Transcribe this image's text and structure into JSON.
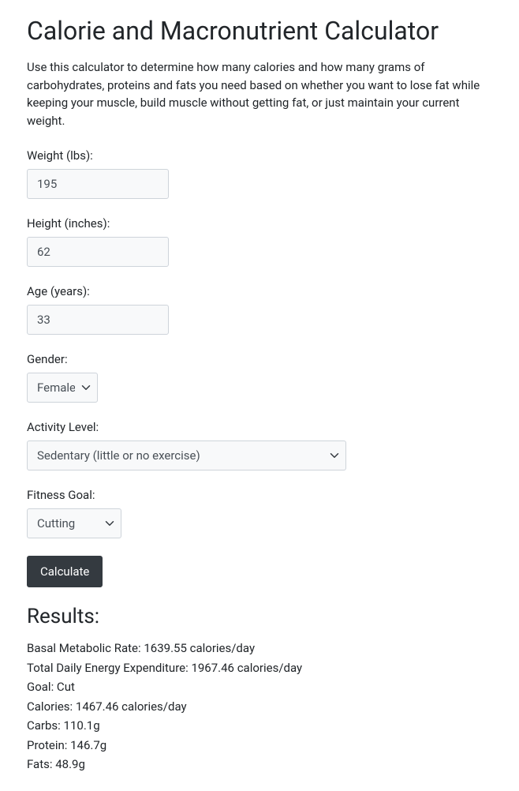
{
  "title": "Calorie and Macronutrient Calculator",
  "intro": "Use this calculator to determine how many calories and how many grams of carbohydrates, proteins and fats you need based on whether you want to lose fat while keeping your muscle, build muscle without getting fat, or just maintain your current weight.",
  "form": {
    "weight": {
      "label": "Weight (lbs):",
      "value": "195"
    },
    "height": {
      "label": "Height (inches):",
      "value": "62"
    },
    "age": {
      "label": "Age (years):",
      "value": "33"
    },
    "gender": {
      "label": "Gender:",
      "value": "Female"
    },
    "activity": {
      "label": "Activity Level:",
      "value": "Sedentary (little or no exercise)"
    },
    "goal": {
      "label": "Fitness Goal:",
      "value": "Cutting"
    },
    "submit": "Calculate"
  },
  "results": {
    "heading": "Results:",
    "bmr": "Basal Metabolic Rate: 1639.55 calories/day",
    "tdee": "Total Daily Energy Expenditure: 1967.46 calories/day",
    "goal": "Goal: Cut",
    "calories": "Calories: 1467.46 calories/day",
    "carbs": "Carbs: 110.1g",
    "protein": "Protein: 146.7g",
    "fats": "Fats: 48.9g"
  }
}
